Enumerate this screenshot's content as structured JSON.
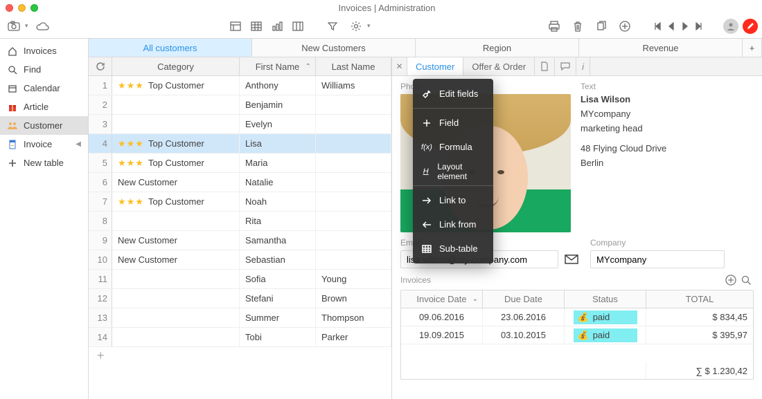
{
  "window": {
    "title": "Invoices | Administration"
  },
  "sidebar": {
    "items": [
      {
        "label": "Invoices",
        "icon": "home"
      },
      {
        "label": "Find",
        "icon": "search"
      },
      {
        "label": "Calendar",
        "icon": "calendar"
      },
      {
        "label": "Article",
        "icon": "gift"
      },
      {
        "label": "Customer",
        "icon": "people"
      },
      {
        "label": "Invoice",
        "icon": "invoice",
        "expandable": true
      },
      {
        "label": "New table",
        "icon": "plus"
      }
    ],
    "selected_index": 4
  },
  "view_tabs": {
    "items": [
      "All customers",
      "New Customers",
      "Region",
      "Revenue"
    ],
    "selected_index": 0
  },
  "grid": {
    "header": {
      "category": "Category",
      "first": "First Name",
      "last": "Last Name",
      "sort": "asc"
    },
    "selected_row": 3,
    "rows": [
      {
        "n": "1",
        "stars": 3,
        "category": "Top Customer",
        "first": "Anthony",
        "last": "Williams"
      },
      {
        "n": "2",
        "stars": 0,
        "category": "",
        "first": "Benjamin",
        "last": ""
      },
      {
        "n": "3",
        "stars": 0,
        "category": "",
        "first": "Evelyn",
        "last": ""
      },
      {
        "n": "4",
        "stars": 3,
        "category": "Top Customer",
        "first": "Lisa",
        "last": ""
      },
      {
        "n": "5",
        "stars": 3,
        "category": "Top Customer",
        "first": "Maria",
        "last": ""
      },
      {
        "n": "6",
        "stars": 0,
        "category": "New Customer",
        "first": "Natalie",
        "last": ""
      },
      {
        "n": "7",
        "stars": 3,
        "category": "Top Customer",
        "first": "Noah",
        "last": ""
      },
      {
        "n": "8",
        "stars": 0,
        "category": "",
        "first": "Rita",
        "last": ""
      },
      {
        "n": "9",
        "stars": 0,
        "category": "New Customer",
        "first": "Samantha",
        "last": ""
      },
      {
        "n": "10",
        "stars": 0,
        "category": "New Customer",
        "first": "Sebastian",
        "last": ""
      },
      {
        "n": "11",
        "stars": 0,
        "category": "",
        "first": "Sofia",
        "last": "Young"
      },
      {
        "n": "12",
        "stars": 0,
        "category": "",
        "first": "Stefani",
        "last": "Brown"
      },
      {
        "n": "13",
        "stars": 0,
        "category": "",
        "first": "Summer",
        "last": "Thompson"
      },
      {
        "n": "14",
        "stars": 0,
        "category": "",
        "first": "Tobi",
        "last": "Parker"
      }
    ]
  },
  "context_menu": {
    "items": [
      "Edit fields",
      "Field",
      "Formula",
      "Layout element",
      "Link to",
      "Link from",
      "Sub-table"
    ]
  },
  "detail": {
    "tabs": [
      "Customer",
      "Offer & Order"
    ],
    "selected_index": 0,
    "photo_label": "Photo",
    "text_label": "Text",
    "text": {
      "name": "Lisa Wilson",
      "company": "MYcompany",
      "role": "marketing head",
      "street": "48 Flying Cloud Drive",
      "city": "Berlin"
    },
    "email": {
      "label": "Email",
      "value": "lisa.wilson@my-company.com"
    },
    "company": {
      "label": "Company",
      "value": "MYcompany"
    },
    "invoices": {
      "label": "Invoices",
      "columns": {
        "date": "Invoice Date",
        "due": "Due Date",
        "status": "Status",
        "total": "TOTAL"
      },
      "rows": [
        {
          "date": "09.06.2016",
          "due": "23.06.2016",
          "status": "paid",
          "total": "$ 834,45"
        },
        {
          "date": "19.09.2015",
          "due": "03.10.2015",
          "status": "paid",
          "total": "$ 395,97"
        }
      ],
      "sum": "∑  $ 1.230,42"
    }
  }
}
